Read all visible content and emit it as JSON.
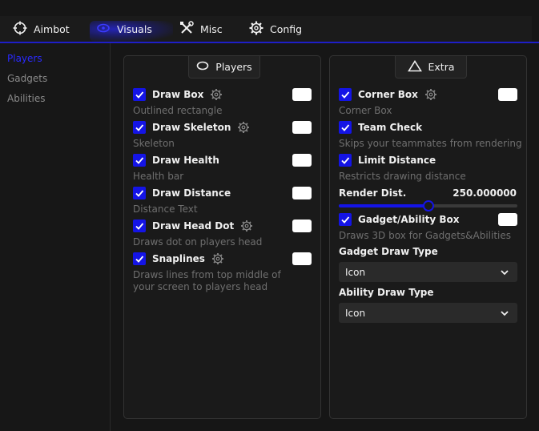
{
  "tabs": [
    {
      "label": "Aimbot",
      "icon": "crosshair-icon"
    },
    {
      "label": "Visuals",
      "icon": "eye-icon",
      "active": true
    },
    {
      "label": "Misc",
      "icon": "tools-icon"
    },
    {
      "label": "Config",
      "icon": "gear-icon"
    }
  ],
  "sidebar": {
    "items": [
      {
        "label": "Players",
        "active": true
      },
      {
        "label": "Gadgets"
      },
      {
        "label": "Abilities"
      }
    ]
  },
  "players_panel": {
    "title": "Players",
    "options": [
      {
        "label": "Draw Box",
        "desc": "Outlined rectangle",
        "checked": true,
        "has_gear": true,
        "color": "#ffffff"
      },
      {
        "label": "Draw Skeleton",
        "desc": "Skeleton",
        "checked": true,
        "has_gear": true,
        "color": "#ffffff"
      },
      {
        "label": "Draw Health",
        "desc": "Health bar",
        "checked": true,
        "has_gear": false,
        "color": "#ffffff"
      },
      {
        "label": "Draw Distance",
        "desc": "Distance Text",
        "checked": true,
        "has_gear": false,
        "color": "#ffffff"
      },
      {
        "label": "Draw Head Dot",
        "desc": "Draws dot on players head",
        "checked": true,
        "has_gear": true,
        "color": "#ffffff"
      },
      {
        "label": "Snaplines",
        "desc_line1": "Draws lines from top middle of",
        "desc_line2": "your screen to players head",
        "checked": true,
        "has_gear": true,
        "color": "#ffffff"
      }
    ]
  },
  "extra_panel": {
    "title": "Extra",
    "options": [
      {
        "label": "Corner Box",
        "desc": "Corner Box",
        "checked": true,
        "has_gear": true,
        "color": "#ffffff"
      },
      {
        "label": "Team Check",
        "desc": "Skips your teammates from rendering",
        "checked": true
      },
      {
        "label": "Limit Distance",
        "desc": "Restricts drawing distance",
        "checked": true
      }
    ],
    "render_dist": {
      "label": "Render Dist.",
      "value_text": "250.000000",
      "fraction": 0.5
    },
    "gadget_box": {
      "label": "Gadget/Ability Box",
      "desc": "Draws 3D box for Gadgets&Abilities",
      "checked": true,
      "color": "#ffffff"
    },
    "gadget_draw_type": {
      "label": "Gadget Draw Type",
      "value": "Icon"
    },
    "ability_draw_type": {
      "label": "Ability Draw Type",
      "value": "Icon"
    }
  },
  "colors": {
    "accent": "#1414e6",
    "background": "#161616",
    "panel": "#1a1a1a"
  }
}
